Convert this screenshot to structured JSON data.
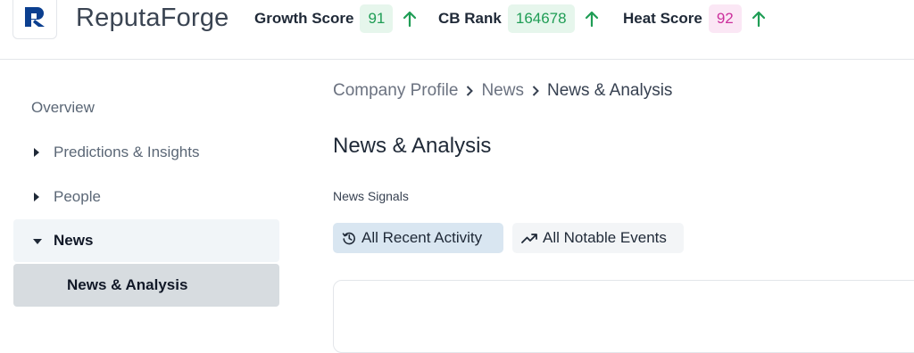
{
  "header": {
    "brand": "ReputaForge",
    "metrics": [
      {
        "label": "Growth Score",
        "value": "91",
        "trend": "up",
        "color": "#1f9d55"
      },
      {
        "label": "CB Rank",
        "value": "164678",
        "trend": "up",
        "color": "#1f9d55"
      },
      {
        "label": "Heat Score",
        "value": "92",
        "trend": "up",
        "color": "#cc2f9c"
      }
    ]
  },
  "sidebar": {
    "items": [
      {
        "label": "Overview"
      },
      {
        "label": "Predictions & Insights",
        "icon": "caret-right-icon"
      },
      {
        "label": "People",
        "icon": "caret-right-icon"
      },
      {
        "label": "News",
        "icon": "caret-down-icon",
        "expanded": true
      },
      {
        "label": "News & Analysis",
        "selected": true
      }
    ]
  },
  "main": {
    "breadcrumb": [
      "Company Profile",
      "News",
      "News & Analysis"
    ],
    "title": "News & Analysis",
    "section_label": "News Signals",
    "filters": [
      {
        "label": "All Recent Activity",
        "icon": "history-icon",
        "selected": true
      },
      {
        "label": "All Notable Events",
        "icon": "trending-up-icon",
        "selected": false
      }
    ]
  }
}
